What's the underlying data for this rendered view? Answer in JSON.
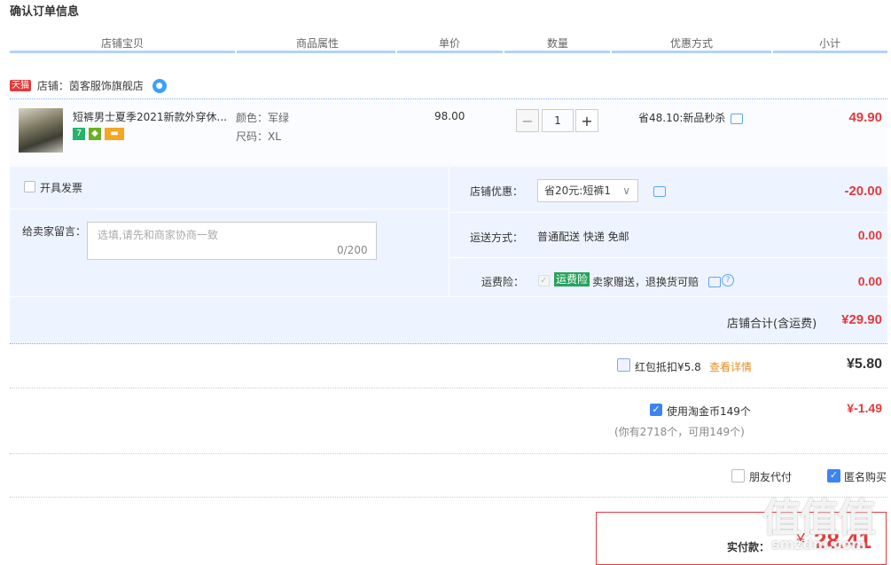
{
  "title": "确认订单信息",
  "columns": [
    "店铺宝贝",
    "商品属性",
    "单价",
    "数量",
    "优惠方式",
    "小计"
  ],
  "shop": {
    "badge": "天猫",
    "label": "店铺：茵客服饰旗舰店"
  },
  "item": {
    "name": "短裤男士夏季2021新款外穿休...",
    "tag_seven": "7",
    "color": "颜色：军绿",
    "size": "尺码：XL",
    "unit_price": "98.00",
    "quantity": "1",
    "qty_minus": "−",
    "qty_plus": "+",
    "discount": "省48.10:新品秒杀",
    "subtotal": "49.90"
  },
  "invoice": {
    "label": "开具发票"
  },
  "message": {
    "label": "给卖家留言：",
    "placeholder": "选填,请先和商家协商一致",
    "counter": "0/200"
  },
  "shop_discount": {
    "label": "店铺优惠：",
    "selected": "省20元:短裤1",
    "amount": "-20.00"
  },
  "shipping": {
    "label": "运送方式：",
    "value": "普通配送 快递 免邮",
    "amount": "0.00"
  },
  "insurance": {
    "label": "运费险：",
    "badge": "运费险",
    "text": "卖家赠送，退换货可赔",
    "amount": "0.00"
  },
  "shop_total": {
    "label": "店铺合计(含运费)",
    "amount": "¥29.90"
  },
  "red_packet": {
    "label": "红包抵扣¥5.8",
    "link": "查看详情",
    "amount": "¥5.80"
  },
  "taobao_coin": {
    "label": "使用淘金币149个",
    "note": "(你有2718个，可用149个)",
    "amount": "¥-1.49"
  },
  "options": {
    "friend_pay": "朋友代付",
    "anonymous": "匿名购买"
  },
  "pay": {
    "label": "实付款：",
    "currency": "¥",
    "amount": "28.41"
  },
  "watermark": {
    "glyphs": "值值值",
    "site": "smzdm.com"
  },
  "colors": {
    "accent_red": "#e4393c",
    "accent_blue": "#3c83f4",
    "panel_bg": "#eef4ff"
  }
}
